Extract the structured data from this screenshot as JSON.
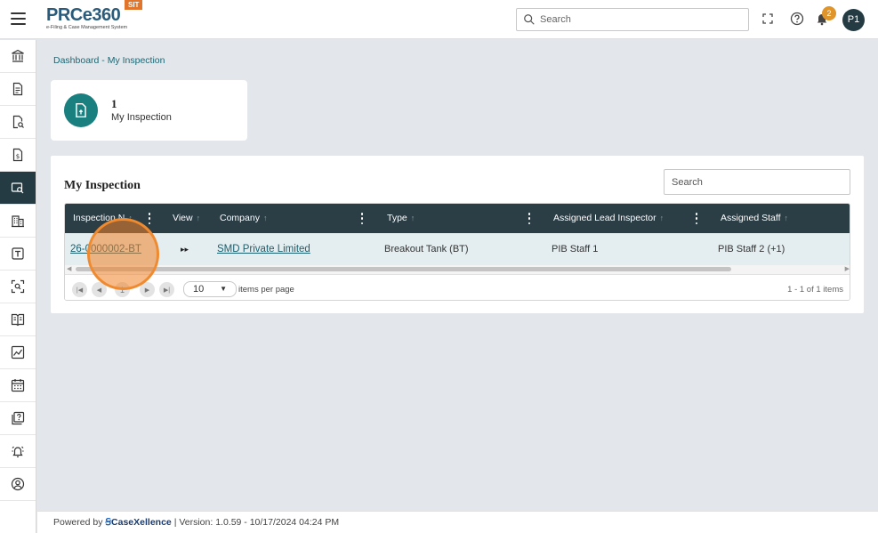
{
  "header": {
    "logo_main": "PRCe360",
    "logo_sub": "e-Filing & Case Management System",
    "env_badge": "SIT",
    "search_placeholder": "Search",
    "notification_count": "2",
    "avatar_initials": "P1"
  },
  "breadcrumb": "Dashboard - My Inspection",
  "kpi": {
    "value": "1",
    "label": "My Inspection"
  },
  "panel": {
    "title": "My Inspection",
    "search_placeholder": "Search",
    "columns": [
      "Inspection N",
      "View",
      "Company",
      "Type",
      "Assigned Lead Inspector",
      "Assigned Staff"
    ],
    "rows": [
      {
        "inspection_no": "26-0000002-BT",
        "company": "SMD Private Limited",
        "type": "Breakout Tank (BT)",
        "lead_inspector": "PIB Staff 1",
        "staff": "PIB Staff 2 (+1)"
      }
    ],
    "pager": {
      "current_page": "1",
      "page_size": "10",
      "items_per_page_label": "items per page",
      "info": "1 - 1 of 1 items"
    }
  },
  "footer": {
    "powered_by": "Powered by",
    "brand": "CaseXellence",
    "version": "|  Version: 1.0.59 - 10/17/2024 04:24 PM"
  }
}
